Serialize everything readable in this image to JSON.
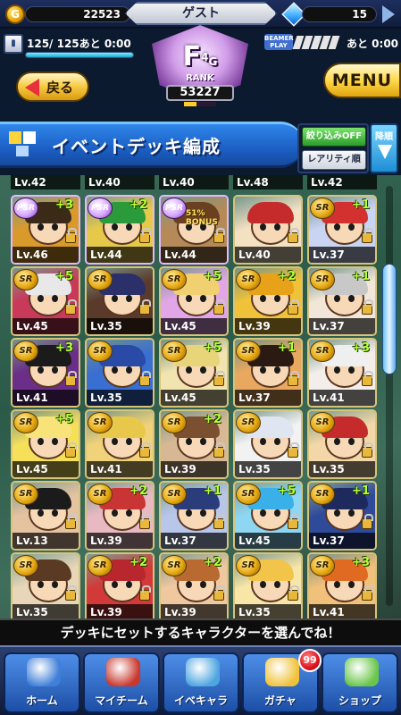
{
  "header": {
    "coins": "22523",
    "player_name": "ゲスト",
    "gems": "15",
    "stamina_text": "125/ 125あと 0:00",
    "stamina_fraction": 1.0,
    "rank_letter": "F",
    "rank_superscript": "4",
    "rank_subscript": "G",
    "rank_label": "RANK",
    "rank_score": "53227",
    "rank_progress_fraction": 0.4,
    "energy_badge": "BEAMER PLAY",
    "energy_text": "あと 0:00",
    "back_label": "戻る",
    "menu_label": "MENU"
  },
  "title_bar": {
    "title": "イベントデッキ編成",
    "filter_label": "絞り込みOFF",
    "rarity_label": "レアリティ順",
    "sort_label": "降順"
  },
  "grid": {
    "top_row_levels": [
      "Lv.42",
      "Lv.40",
      "Lv.40",
      "Lv.48",
      "Lv.42"
    ],
    "rows": [
      [
        {
          "rarity": "PSR",
          "plus": "+3",
          "level": "Lv.46",
          "bg": "#d99a2c",
          "hair": "#3a2a17"
        },
        {
          "rarity": "PSR",
          "plus": "+2",
          "level": "Lv.44",
          "bg": "#e6c94a",
          "hair": "#2a9a3a"
        },
        {
          "rarity": "PSR",
          "plus": "",
          "level": "Lv.44",
          "bg": "#b58a58",
          "hair": "#6a4020",
          "bonus": "51% BONUS"
        },
        {
          "rarity": "",
          "plus": "",
          "level": "Lv.40",
          "bg": "#f3e1c2",
          "hair": "#c62b2b"
        },
        {
          "rarity": "SR",
          "plus": "+1",
          "level": "Lv.37",
          "bg": "#c9d4f2",
          "hair": "#d33030"
        }
      ],
      [
        {
          "rarity": "SR",
          "plus": "+5",
          "level": "Lv.45",
          "bg": "#c9395a",
          "hair": "#e8e8e8"
        },
        {
          "rarity": "SR",
          "plus": "",
          "level": "Lv.35",
          "bg": "#5a3a2a",
          "hair": "#2b2f6a"
        },
        {
          "rarity": "SR",
          "plus": "+5",
          "level": "Lv.45",
          "bg": "#e2a6e8",
          "hair": "#f0d070"
        },
        {
          "rarity": "SR",
          "plus": "+2",
          "level": "Lv.39",
          "bg": "#f0c23a",
          "hair": "#e7a21a"
        },
        {
          "rarity": "SR",
          "plus": "+1",
          "level": "Lv.37",
          "bg": "#f2e6d8",
          "hair": "#c8c8c8"
        }
      ],
      [
        {
          "rarity": "SR",
          "plus": "+3",
          "level": "Lv.41",
          "bg": "#6b2f8a",
          "hair": "#1b1b1b"
        },
        {
          "rarity": "SR",
          "plus": "",
          "level": "Lv.35",
          "bg": "#3a6fd2",
          "hair": "#2a4aa8"
        },
        {
          "rarity": "SR",
          "plus": "+5",
          "level": "Lv.45",
          "bg": "#f2e4b0",
          "hair": "#e8d57a"
        },
        {
          "rarity": "SR",
          "plus": "+1",
          "level": "Lv.37",
          "bg": "#e9a860",
          "hair": "#2a1a12"
        },
        {
          "rarity": "SR",
          "plus": "+3",
          "level": "Lv.41",
          "bg": "#f3eeea",
          "hair": "#efefef"
        }
      ],
      [
        {
          "rarity": "SR",
          "plus": "+5",
          "level": "Lv.45",
          "bg": "#f6e05a",
          "hair": "#f7e37a"
        },
        {
          "rarity": "SR",
          "plus": "",
          "level": "Lv.41",
          "bg": "#efd27a",
          "hair": "#e8c84a"
        },
        {
          "rarity": "SR",
          "plus": "+2",
          "level": "Lv.39",
          "bg": "#d8b894",
          "hair": "#7a5030"
        },
        {
          "rarity": "SR",
          "plus": "",
          "level": "Lv.35",
          "bg": "#f2f2f2",
          "hair": "#dfe6f2"
        },
        {
          "rarity": "SR",
          "plus": "",
          "level": "Lv.35",
          "bg": "#f3d7a8",
          "hair": "#c62b2b"
        }
      ],
      [
        {
          "rarity": "SR",
          "plus": "",
          "level": "Lv.13",
          "bg": "#e6c3a0",
          "hair": "#1b1b1b"
        },
        {
          "rarity": "SR",
          "plus": "+2",
          "level": "Lv.39",
          "bg": "#e8b9c2",
          "hair": "#c93535"
        },
        {
          "rarity": "SR",
          "plus": "+1",
          "level": "Lv.37",
          "bg": "#b8c6ea",
          "hair": "#2b3c7a"
        },
        {
          "rarity": "SR",
          "plus": "+5",
          "level": "Lv.45",
          "bg": "#8ed6f2",
          "hair": "#3ab0e8"
        },
        {
          "rarity": "SR",
          "plus": "+1",
          "level": "Lv.37",
          "bg": "#304a9a",
          "hair": "#1e2a5e"
        }
      ],
      [
        {
          "rarity": "SR",
          "plus": "",
          "level": "Lv.35",
          "bg": "#e8d6b8",
          "hair": "#5a3a22"
        },
        {
          "rarity": "SR",
          "plus": "+2",
          "level": "Lv.39",
          "bg": "#d23a3a",
          "hair": "#b8272d"
        },
        {
          "rarity": "SR",
          "plus": "+2",
          "level": "Lv.39",
          "bg": "#f0c8a0",
          "hair": "#b86a30"
        },
        {
          "rarity": "SR",
          "plus": "",
          "level": "Lv.35",
          "bg": "#f7e6a8",
          "hair": "#f2c44a"
        },
        {
          "rarity": "SR",
          "plus": "+3",
          "level": "Lv.41",
          "bg": "#f1c07a",
          "hair": "#e06a22"
        }
      ]
    ],
    "scroll_fraction": 0.25
  },
  "instruction": "デッキにセットするキャラクターを選んでね！",
  "nav": [
    {
      "label": "ホーム",
      "art": "#3f7fd8"
    },
    {
      "label": "マイチーム",
      "art": "#c9382e"
    },
    {
      "label": "イベキャラ",
      "art": "#4ea6e0"
    },
    {
      "label": "ガチャ",
      "art": "#f0c23a"
    },
    {
      "label": "ショップ",
      "art": "#6ac64a"
    }
  ],
  "gacha_badge": "99"
}
